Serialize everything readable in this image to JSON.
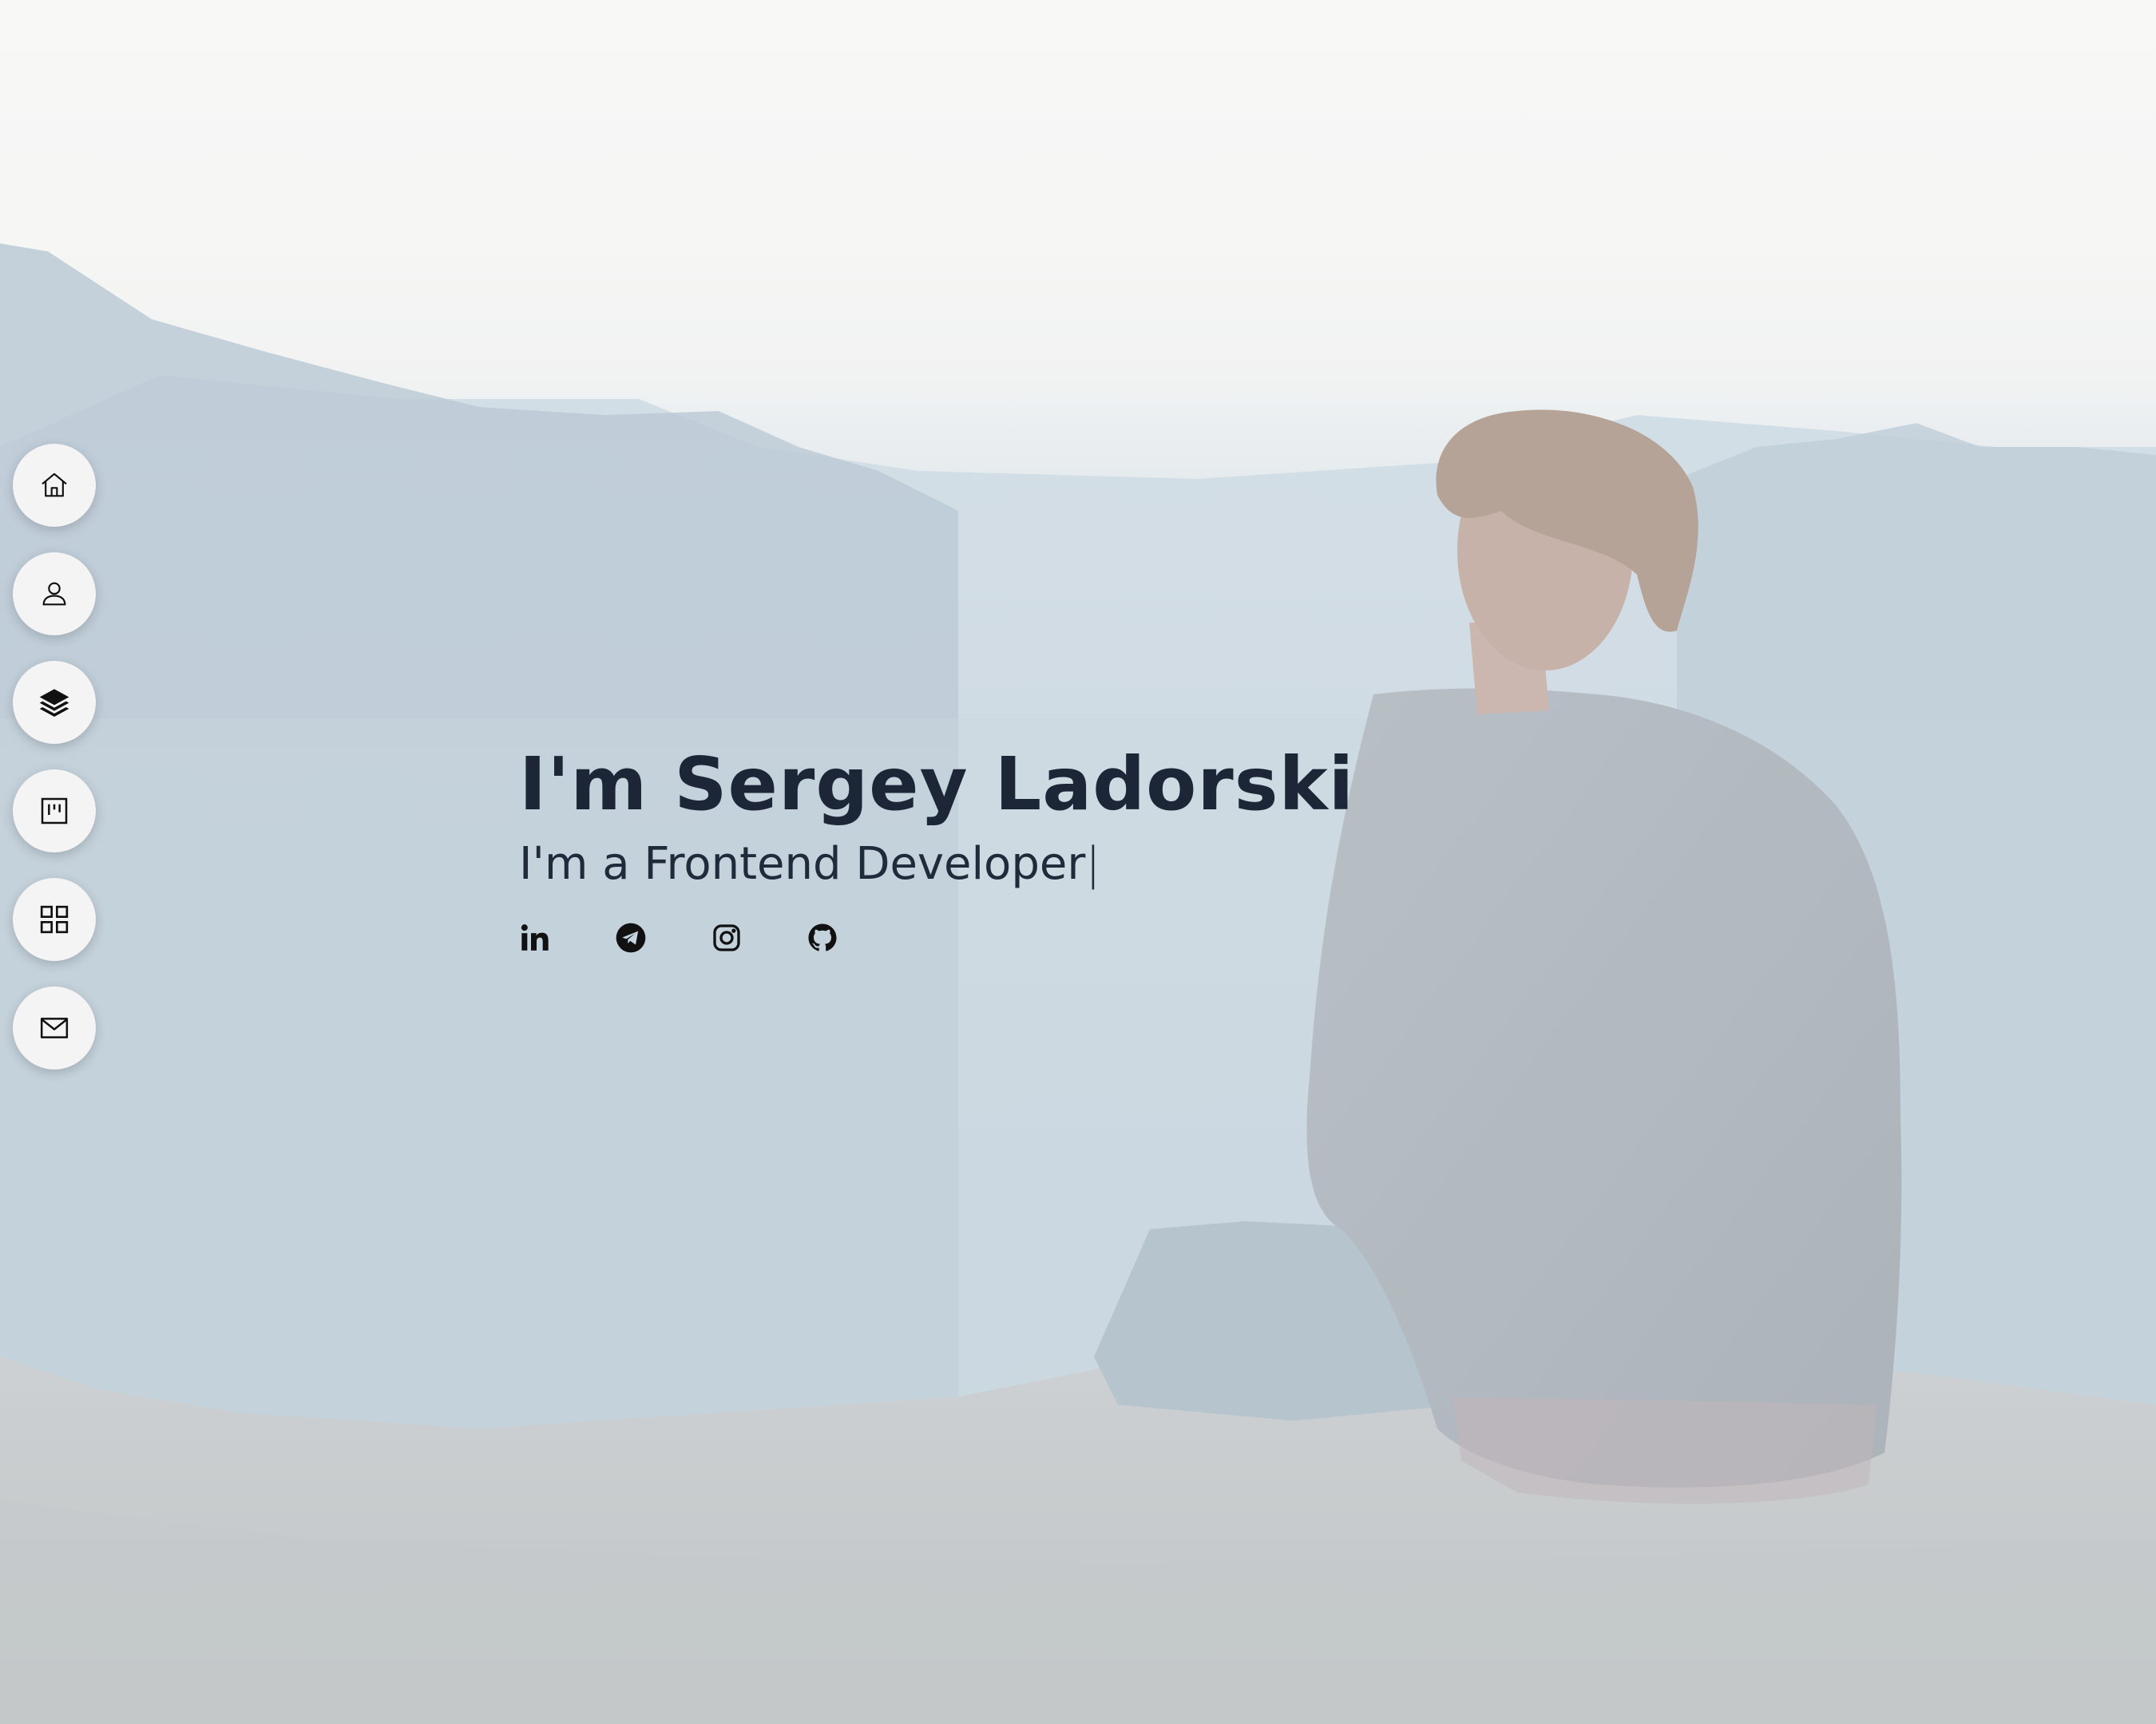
{
  "hero": {
    "name": "I'm Sergey Ladorski",
    "subtitle_prefix": "I'm a",
    "subtitle_role": "Frontend Developer",
    "cursor": "|"
  },
  "nav": [
    {
      "id": "home",
      "icon": "home-icon"
    },
    {
      "id": "about",
      "icon": "user-icon"
    },
    {
      "id": "resume",
      "icon": "layers-icon"
    },
    {
      "id": "portfolio",
      "icon": "kanban-icon"
    },
    {
      "id": "services",
      "icon": "grid-icon"
    },
    {
      "id": "contact",
      "icon": "envelope-icon"
    }
  ],
  "socials": [
    {
      "id": "linkedin",
      "icon": "linkedin-icon"
    },
    {
      "id": "telegram",
      "icon": "telegram-icon"
    },
    {
      "id": "instagram",
      "icon": "instagram-icon"
    },
    {
      "id": "github",
      "icon": "github-icon"
    }
  ],
  "colors": {
    "text": "#1c2637",
    "nav_bg": "#f4f4f5",
    "sky": "#f4f4f2",
    "haze": "#bccdd8",
    "rock": "#bcc2c4"
  }
}
